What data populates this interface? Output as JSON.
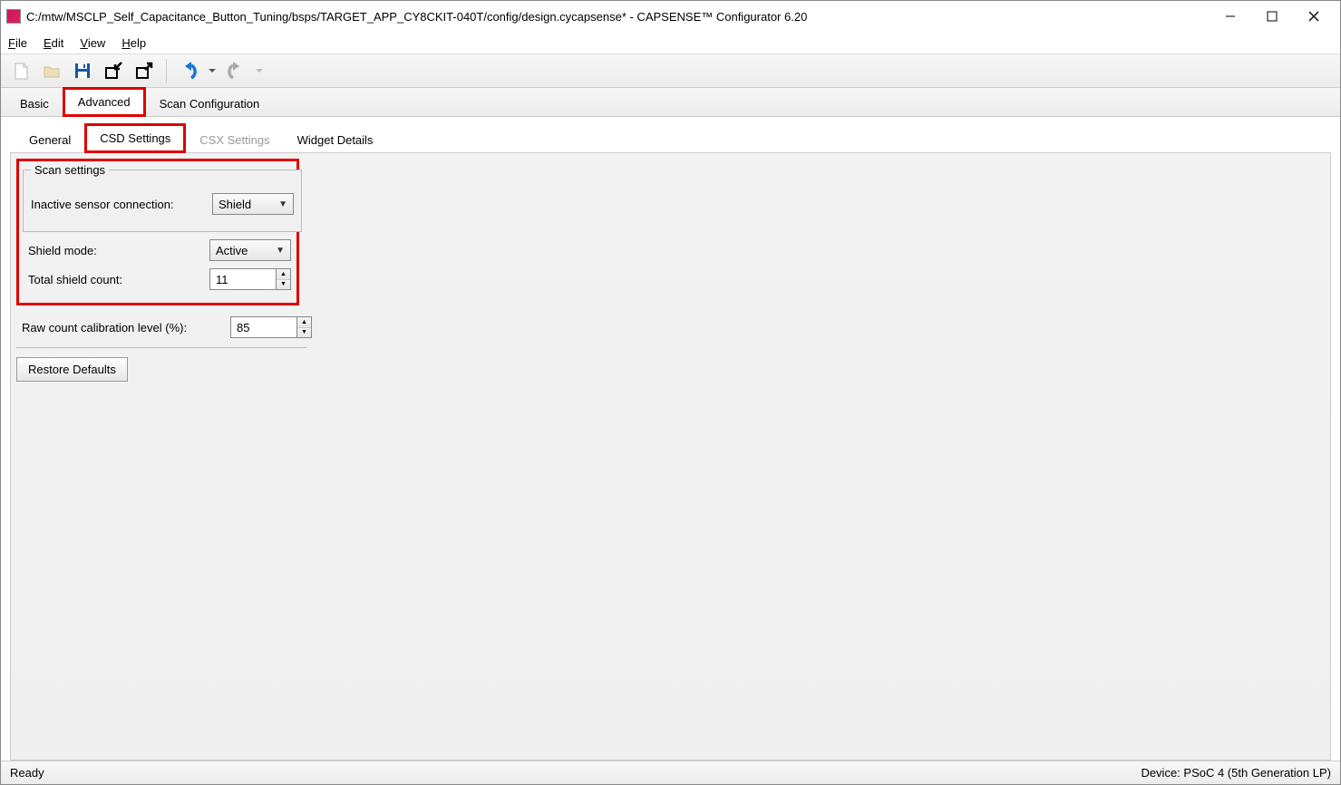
{
  "window": {
    "title": "C:/mtw/MSCLP_Self_Capacitance_Button_Tuning/bsps/TARGET_APP_CY8CKIT-040T/config/design.cycapsense* - CAPSENSE™ Configurator 6.20"
  },
  "menu": {
    "file": "File",
    "edit": "Edit",
    "view": "View",
    "help": "Help"
  },
  "primary_tabs": {
    "basic": "Basic",
    "advanced": "Advanced",
    "scan_config": "Scan Configuration"
  },
  "secondary_tabs": {
    "general": "General",
    "csd": "CSD Settings",
    "csx": "CSX Settings",
    "widget": "Widget Details"
  },
  "scan_settings": {
    "legend": "Scan settings",
    "inactive_label": "Inactive sensor connection:",
    "inactive_value": "Shield",
    "shield_mode_label": "Shield mode:",
    "shield_mode_value": "Active",
    "total_shield_label": "Total shield count:",
    "total_shield_value": "11"
  },
  "calibration": {
    "label": "Raw count calibration level (%):",
    "value": "85"
  },
  "restore_button": "Restore Defaults",
  "status": {
    "ready": "Ready",
    "device": "Device: PSoC 4 (5th Generation LP)"
  }
}
